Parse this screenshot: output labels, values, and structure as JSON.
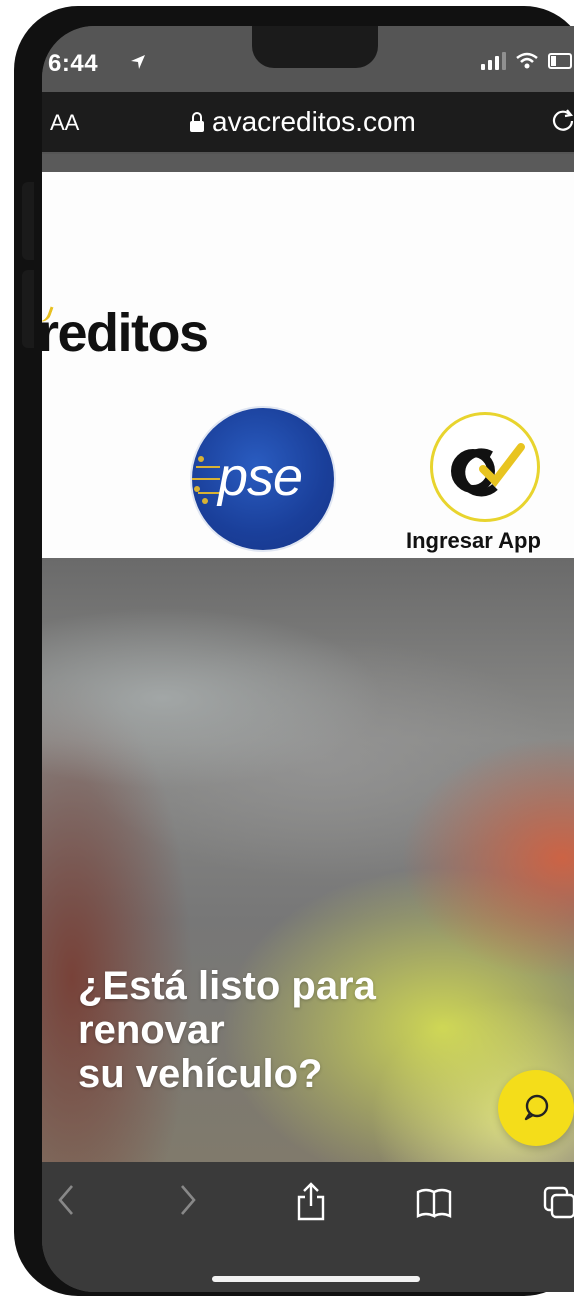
{
  "status": {
    "time": "6:44",
    "icons": [
      "location-arrow-icon",
      "signal-icon",
      "wifi-icon",
      "battery-icon"
    ]
  },
  "browser": {
    "aa_label": "AA",
    "domain": "avacreditos.com",
    "icons": [
      "lock-icon",
      "reload-icon"
    ]
  },
  "header": {
    "logo_text": "reditos",
    "pse_text": "pse",
    "app_button_label": "Ingresar App"
  },
  "hero": {
    "headline_lines": [
      "¿Está listo para",
      "renovar",
      "su vehículo?"
    ]
  },
  "toolbar": {
    "icons": [
      "back-icon",
      "forward-icon",
      "share-icon",
      "bookmarks-icon",
      "tabs-icon"
    ]
  },
  "colors": {
    "chat_button": "#f4dd1a",
    "app_logo_ring": "#e8d42e",
    "pse_blue": "#1a3f9a",
    "toolbar": "#3a3a3a"
  }
}
